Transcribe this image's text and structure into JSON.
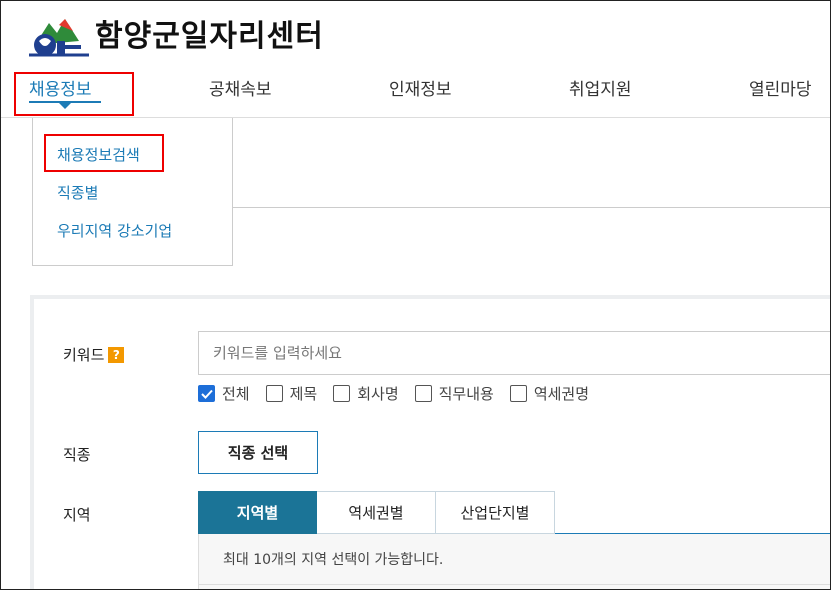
{
  "header": {
    "logo_text": "함양군일자리센터",
    "logo_icon": "hamyang-emblem-icon"
  },
  "gnb": {
    "items": [
      {
        "label": "채용정보",
        "active": true
      },
      {
        "label": "공채속보",
        "active": false
      },
      {
        "label": "인재정보",
        "active": false
      },
      {
        "label": "취업지원",
        "active": false
      },
      {
        "label": "열린마당",
        "active": false
      }
    ]
  },
  "dropdown": {
    "items": [
      {
        "label": "채용정보검색"
      },
      {
        "label": "직종별"
      },
      {
        "label": "우리지역 강소기업"
      }
    ]
  },
  "search": {
    "keyword_label": "키워드",
    "help_icon": "?",
    "keyword_placeholder": "키워드를 입력하세요",
    "keyword_value": "",
    "checkboxes": [
      {
        "label": "전체",
        "checked": true
      },
      {
        "label": "제목",
        "checked": false
      },
      {
        "label": "회사명",
        "checked": false
      },
      {
        "label": "직무내용",
        "checked": false
      },
      {
        "label": "역세권명",
        "checked": false
      }
    ],
    "job_label": "직종",
    "job_button": "직종 선택",
    "region_label": "지역",
    "region_tabs": [
      {
        "label": "지역별",
        "active": true
      },
      {
        "label": "역세권별",
        "active": false
      },
      {
        "label": "산업단지별",
        "active": false
      }
    ],
    "region_notice": "최대 10개의 지역 선택이 가능합니다."
  },
  "colors": {
    "accent": "#1c7bb6",
    "tab_active": "#1b7497",
    "highlight": "#ee0000",
    "help_badge": "#f39800"
  }
}
